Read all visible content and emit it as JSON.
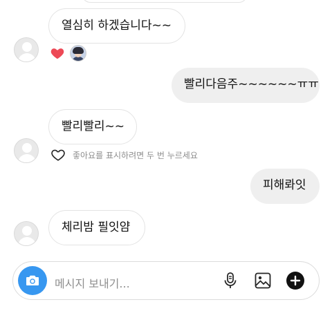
{
  "messages": [
    {
      "text": "열심히 하겠습니다~~"
    },
    {
      "text": "빨리다음주~~~~~~ㅠㅠ"
    },
    {
      "text": "빨리빨리~~"
    },
    {
      "text": "피해롸잇"
    },
    {
      "text": "체리밤 필잇얌"
    }
  ],
  "like_hint": "좋아요를 표시하려면 두 번 누르세요",
  "composer": {
    "placeholder": "메시지 보내기..."
  },
  "icons": {
    "reaction": "heart-icon",
    "camera": "camera-icon",
    "mic": "microphone-icon",
    "gallery": "image-icon",
    "add": "plus-circle-icon",
    "like": "heart-outline-icon"
  },
  "colors": {
    "reaction_heart": "#ed4956",
    "camera_button": "#3797f0",
    "hint_text": "#8e8e8e"
  }
}
